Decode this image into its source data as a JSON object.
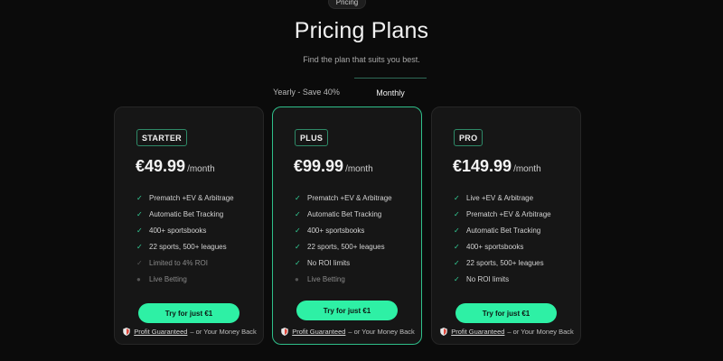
{
  "header": {
    "pill_label": "Pricing",
    "title": "Pricing Plans",
    "subtitle": "Find the plan that suits you best."
  },
  "billing_toggle": {
    "yearly_label": "Yearly - Save 40%",
    "monthly_label": "Monthly",
    "selected": "Monthly"
  },
  "plans": [
    {
      "badge": "STARTER",
      "price": "€49.99",
      "period": "/month",
      "features": [
        {
          "label": "Prematch +EV & Arbitrage",
          "included": true
        },
        {
          "label": "Automatic Bet Tracking",
          "included": true
        },
        {
          "label": "400+ sportsbooks",
          "included": true
        },
        {
          "label": "22 sports, 500+ leagues",
          "included": true
        },
        {
          "label": "Limited to 4% ROI",
          "included": false
        },
        {
          "label": "Live Betting",
          "included": false
        }
      ],
      "cta": "Try for just €1",
      "guarantee_link": "Profit Guaranteed",
      "guarantee_rest": "– or Your Money Back"
    },
    {
      "badge": "PLUS",
      "price": "€99.99",
      "period": "/month",
      "featured": true,
      "features": [
        {
          "label": "Prematch +EV & Arbitrage",
          "included": true
        },
        {
          "label": "Automatic Bet Tracking",
          "included": true
        },
        {
          "label": "400+ sportsbooks",
          "included": true
        },
        {
          "label": "22 sports, 500+ leagues",
          "included": true
        },
        {
          "label": "No ROI limits",
          "included": true
        },
        {
          "label": "Live Betting",
          "included": false
        }
      ],
      "cta": "Try for just €1",
      "guarantee_link": "Profit Guaranteed",
      "guarantee_rest": "– or Your Money Back"
    },
    {
      "badge": "PRO",
      "price": "€149.99",
      "period": "/month",
      "features": [
        {
          "label": "Live +EV & Arbitrage",
          "included": true
        },
        {
          "label": "Prematch +EV & Arbitrage",
          "included": true
        },
        {
          "label": "Automatic Bet Tracking",
          "included": true
        },
        {
          "label": "400+ sportsbooks",
          "included": true
        },
        {
          "label": "22 sports, 500+ leagues",
          "included": true
        },
        {
          "label": "No ROI limits",
          "included": true
        }
      ],
      "cta": "Try for just €1",
      "guarantee_link": "Profit Guaranteed",
      "guarantee_rest": "– or Your Money Back"
    }
  ],
  "colors": {
    "accent": "#2ef0a5",
    "check": "#34d399",
    "background": "#0b0b0b",
    "card": "#161616",
    "featured_border": "#2fbf8a"
  },
  "icons": {
    "check": "check-icon",
    "excluded": "dot-icon",
    "guarantee": "shield-icon"
  }
}
